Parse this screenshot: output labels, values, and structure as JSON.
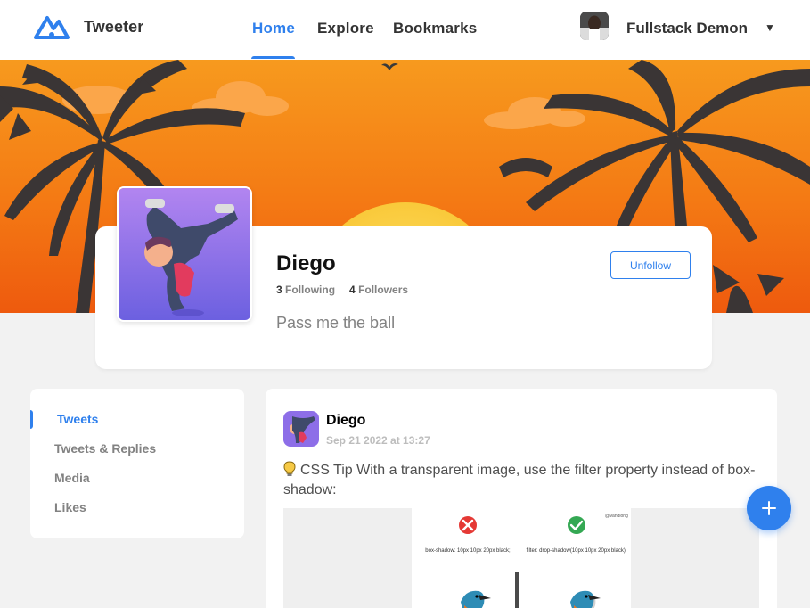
{
  "app": {
    "brand": "Tweeter",
    "logo_icon": "tweeter-logo-icon",
    "accent_color": "#2f80ed"
  },
  "nav": {
    "items": [
      {
        "label": "Home",
        "active": true
      },
      {
        "label": "Explore",
        "active": false
      },
      {
        "label": "Bookmarks",
        "active": false
      }
    ]
  },
  "user": {
    "name": "Fullstack Demon",
    "caret_icon": "caret-down-icon",
    "caret": "▼"
  },
  "profile": {
    "name": "Diego",
    "following_count": "3",
    "following_label": "Following",
    "followers_count": "4",
    "followers_label": "Followers",
    "bio": "Pass me the ball",
    "unfollow_label": "Unfollow"
  },
  "sidebar": {
    "items": [
      {
        "label": "Tweets",
        "active": true
      },
      {
        "label": "Tweets & Replies",
        "active": false
      },
      {
        "label": "Media",
        "active": false
      },
      {
        "label": "Likes",
        "active": false
      }
    ]
  },
  "tweet": {
    "author": "Diego",
    "date": "Sep 21 2022 at 13:27",
    "text": "CSS Tip With a transparent image, use the filter property instead of box-shadow:",
    "image": {
      "left_caption": "box-shadow: 10px 10px 20px black;",
      "right_caption": "filter: drop-shadow(10px 10px 20px black);",
      "watermark": "@Vandlong"
    }
  },
  "fab": {
    "icon": "plus-icon"
  }
}
